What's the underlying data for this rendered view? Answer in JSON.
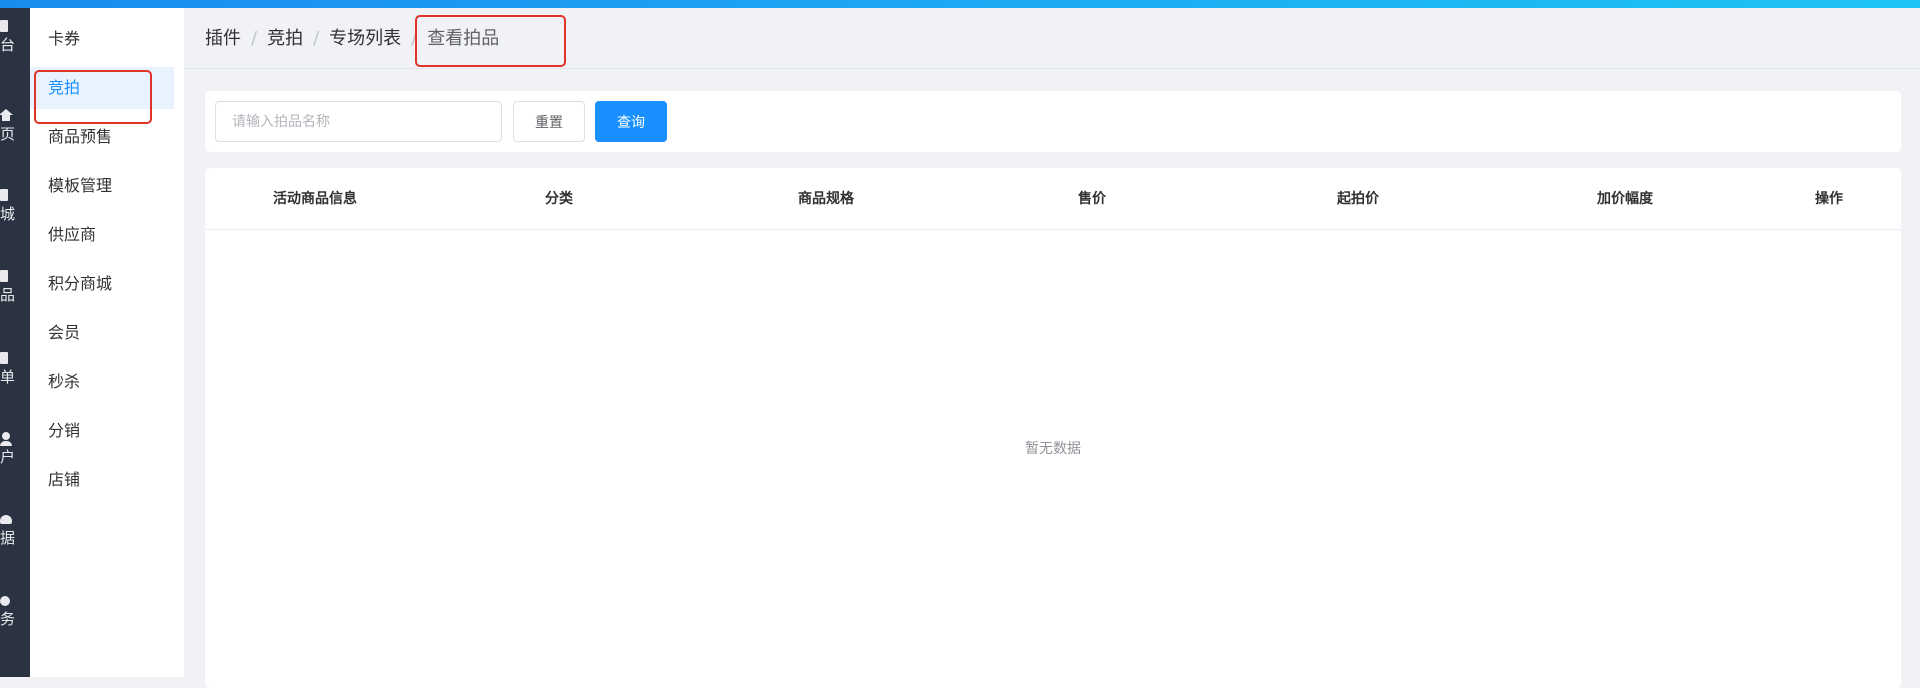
{
  "rail": {
    "items": [
      {
        "label": "台",
        "icon": "dashboard-icon"
      },
      {
        "label": "页",
        "icon": "home-icon"
      },
      {
        "label": "城",
        "icon": "shop-icon"
      },
      {
        "label": "品",
        "icon": "goods-icon"
      },
      {
        "label": "单",
        "icon": "order-icon"
      },
      {
        "label": "户",
        "icon": "user-icon"
      },
      {
        "label": "据",
        "icon": "data-icon"
      },
      {
        "label": "务",
        "icon": "finance-icon"
      }
    ]
  },
  "submenu": {
    "items": [
      {
        "label": "卡券"
      },
      {
        "label": "竞拍",
        "active": true
      },
      {
        "label": "商品预售"
      },
      {
        "label": "模板管理"
      },
      {
        "label": "供应商"
      },
      {
        "label": "积分商城"
      },
      {
        "label": "会员"
      },
      {
        "label": "秒杀"
      },
      {
        "label": "分销"
      },
      {
        "label": "店铺"
      }
    ]
  },
  "breadcrumb": [
    "插件",
    "竞拍",
    "专场列表",
    "查看拍品"
  ],
  "breadcrumb_separator": "/",
  "filter": {
    "search_placeholder": "请输入拍品名称",
    "search_value": "",
    "reset_label": "重置",
    "query_label": "查询"
  },
  "table": {
    "columns": [
      "活动商品信息",
      "分类",
      "商品规格",
      "售价",
      "起拍价",
      "加价幅度",
      "操作"
    ],
    "rows": [],
    "empty_text": "暂无数据"
  },
  "colors": {
    "accent": "#1890ff",
    "highlight": "#e0342a",
    "rail_bg": "#2b3241"
  }
}
